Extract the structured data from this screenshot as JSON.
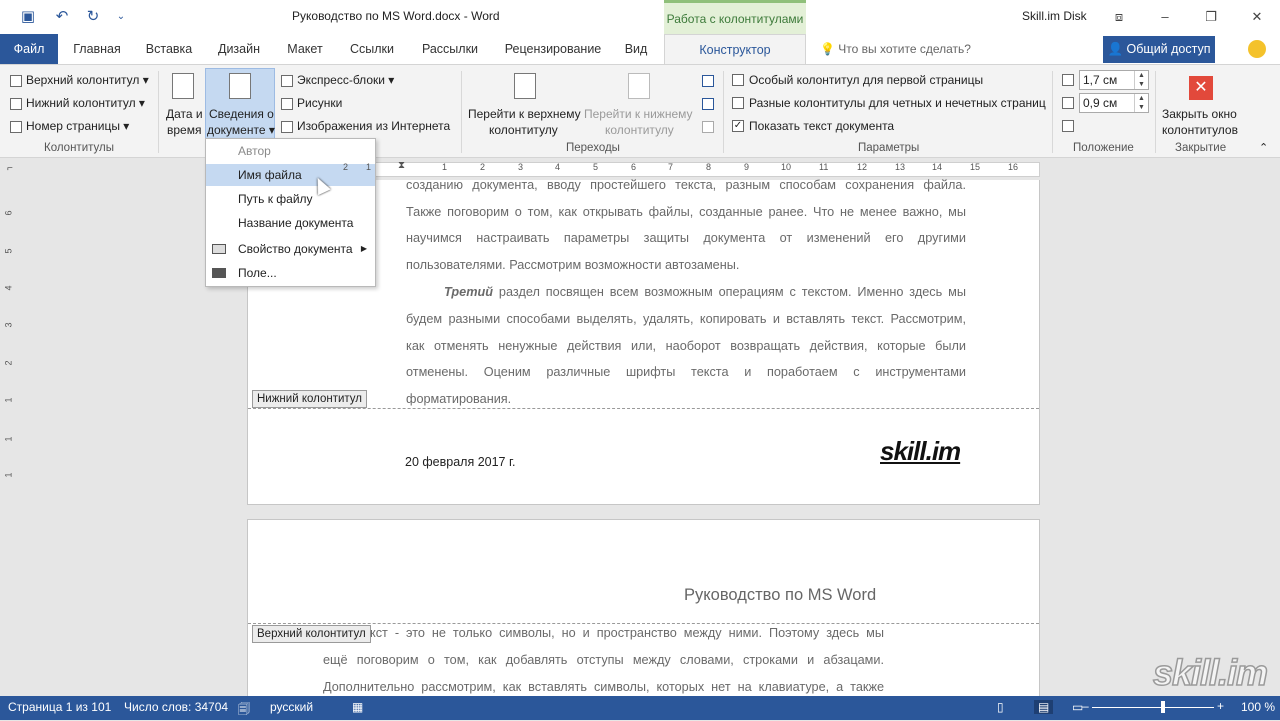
{
  "titlebar": {
    "doc_title": "Руководство по MS Word.docx  -  Word",
    "context_group": "Работа с колонтитулами",
    "disk": "Skill.im Disk"
  },
  "tabs": [
    "Файл",
    "Главная",
    "Вставка",
    "Дизайн",
    "Макет",
    "Ссылки",
    "Рассылки",
    "Рецензирование",
    "Вид",
    "Конструктор"
  ],
  "tellme": "Что вы хотите сделать?",
  "share": "Общий доступ",
  "ribbon": {
    "header": "Верхний колонтитул",
    "footer": "Нижний колонтитул",
    "page_number": "Номер страницы",
    "group_hf": "Колонтитулы",
    "date1": "Дата и",
    "date2": "время",
    "docinfo1": "Сведения о",
    "docinfo2": "документе",
    "quickparts": "Экспресс-блоки",
    "pictures": "Рисунки",
    "online": "Изображения из Интернета",
    "goto_header1": "Перейти к верхнему",
    "goto_header2": "колонтитулу",
    "goto_footer1": "Перейти к нижнему",
    "goto_footer2": "колонтитулу",
    "group_nav": "Переходы",
    "opt1": "Особый колонтитул для первой страницы",
    "opt2": "Разные колонтитулы для четных и нечетных страниц",
    "opt3": "Показать текст документа",
    "group_opts": "Параметры",
    "pos_top": "1,7 см",
    "pos_bottom": "0,9 см",
    "group_pos": "Положение",
    "close1": "Закрыть окно",
    "close2": "колонтитулов",
    "group_close": "Закрытие"
  },
  "menu": {
    "items": [
      "Автор",
      "Имя файла",
      "Путь к файлу",
      "Название документа",
      "Свойство документа",
      "Поле..."
    ]
  },
  "ruler_h": [
    "1",
    "2",
    "1",
    "1",
    "2",
    "3",
    "4",
    "5",
    "6",
    "7",
    "8",
    "9",
    "10",
    "11",
    "12",
    "13",
    "14",
    "15",
    "16"
  ],
  "ruler_v": [
    "6",
    "5",
    "4",
    "3",
    "2",
    "1",
    "1",
    "1"
  ],
  "page1": {
    "lines": [
      "созданию документа, вводу простейшего текста, разным способам сохранения файла.",
      "Также поговорим о том, как открывать файлы, созданные ранее. Что не менее важно, мы",
      "научимся настраивать параметры защиты документа от изменений его другими",
      "пользователями. Рассмотрим возможности автозамены."
    ],
    "p2_bold": "Третий",
    "p2_first": " раздел посвящен всем возможным операциям с текстом. Именно здесь мы",
    "p2_lines": [
      "будем разными способами выделять, удалять, копировать и вставлять текст. Рассмотрим,",
      "как отменять ненужные действия или, наоборот возвращать действия, которые были",
      "отменены. Оценим различные шрифты текста и поработаем с инструментами",
      "форматирования."
    ],
    "footer_tag": "Нижний колонтитул",
    "footer_date": "20 февраля 2017 г.",
    "footer_logo": "skill.im"
  },
  "page2": {
    "header_title": "Руководство по MS Word",
    "header_tag": "Верхний колонтитул",
    "line1": "кст - это не только символы, но и пространство между ними. Поэтому здесь мы",
    "line2": "ещё поговорим о том, как добавлять отступы между словами, строками и абзацами.",
    "line3": "Дополнительно рассмотрим, как вставлять символы, которых нет на клавиатуре, а также"
  },
  "watermark": "skill.im",
  "status": {
    "page": "Страница 1 из 101",
    "words": "Число слов: 34704",
    "lang": "русский",
    "zoom": "100 %"
  }
}
